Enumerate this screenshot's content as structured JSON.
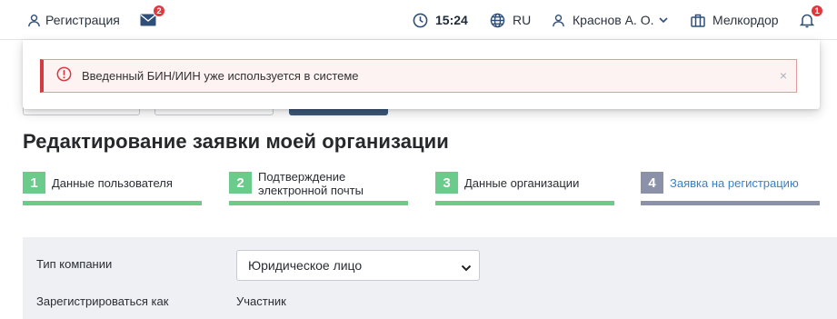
{
  "header": {
    "register_label": "Регистрация",
    "mail_badge": "2",
    "time": "15:24",
    "language": "RU",
    "user_name": "Краснов А. О.",
    "organization": "Мелкордор",
    "notifications_badge": "1"
  },
  "alert": {
    "message": "Введенный БИН/ИИН уже используется в системе",
    "close_symbol": "×",
    "color": "#d33b40"
  },
  "page": {
    "title": "Редактирование заявки моей организации"
  },
  "steps": [
    {
      "number": "1",
      "label": "Данные пользователя",
      "state": "done"
    },
    {
      "number": "2",
      "label_line1": "Подтверждение",
      "label_line2": "электронной почты",
      "state": "done"
    },
    {
      "number": "3",
      "label": "Данные организации",
      "state": "done"
    },
    {
      "number": "4",
      "label": "Заявка на регистрацию",
      "state": "current"
    }
  ],
  "form": {
    "company_type_label": "Тип компании",
    "company_type_value": "Юридическое лицо",
    "register_as_label": "Зарегистрироваться как",
    "register_as_value": "Участник"
  },
  "colors": {
    "step_done": "#6acb8a",
    "step_current": "#8b91a8",
    "link": "#3c7fc9",
    "badge": "#e0383e"
  }
}
